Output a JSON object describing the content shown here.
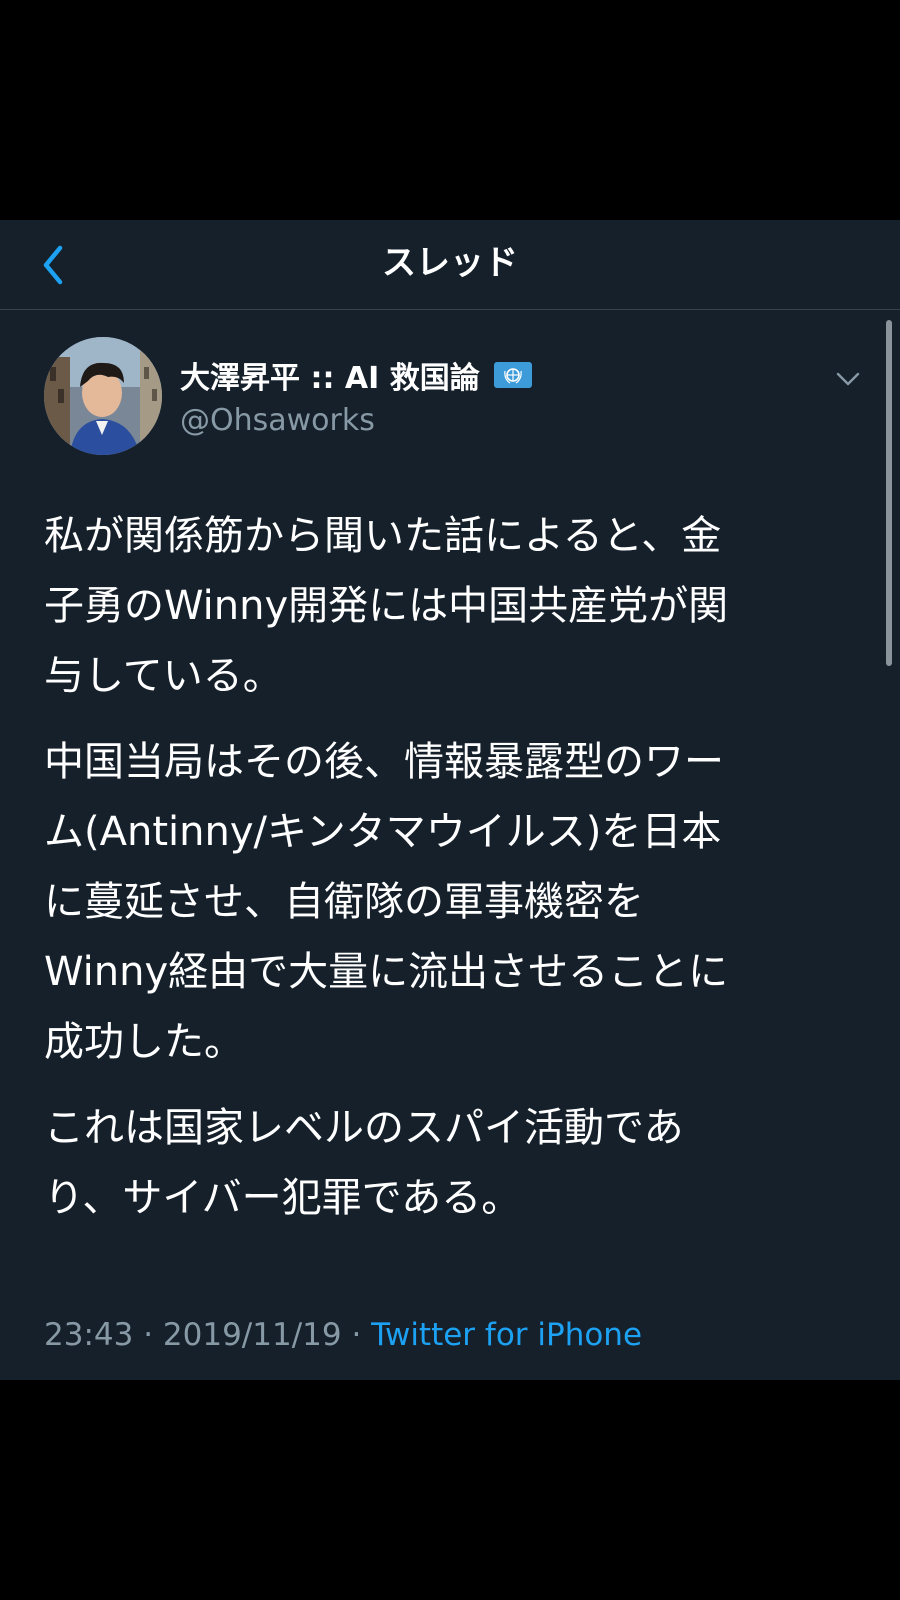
{
  "nav": {
    "title": "スレッド",
    "back_icon": "chevron-left-icon"
  },
  "tweet": {
    "author": {
      "display_name": "大澤昇平 :: AI 救国論",
      "badge_icon": "united-nations-flag-icon",
      "handle": "@Ohsaworks"
    },
    "paragraphs": [
      "私が関係筋から聞いた話によると、金\n子勇のWinny開発には中国共産党が関\n与している。",
      "中国当局はその後、情報暴露型のワー\nム(Antinny/キンタマウイルス)を日本\nに蔓延させ、自衛隊の軍事機密を\nWinny経由で大量に流出させることに\n成功した。",
      "これは国家レベルのスパイ活動であ\nり、サイバー犯罪である。"
    ],
    "time": "23:43",
    "separator": " · ",
    "date": "2019/11/19",
    "source": "Twitter for iPhone"
  },
  "colors": {
    "background": "#15202b",
    "accent": "#1da1f2",
    "secondary_text": "#8899a6",
    "divider": "#38444d"
  }
}
